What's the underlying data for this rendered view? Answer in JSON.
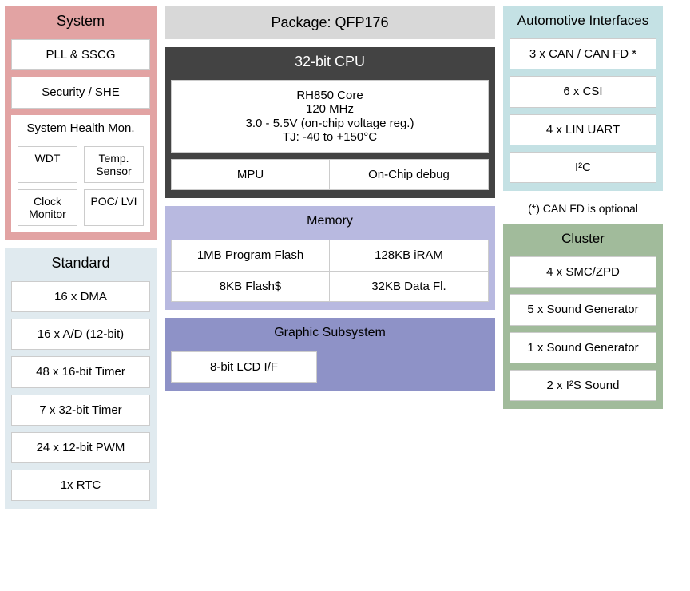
{
  "system": {
    "title": "System",
    "items": [
      "PLL & SSCG",
      "Security / SHE"
    ],
    "health": {
      "title": "System Health Mon.",
      "cells": [
        "WDT",
        "Temp. Sensor",
        "Clock Monitor",
        "POC/ LVI"
      ]
    }
  },
  "standard": {
    "title": "Standard",
    "items": [
      "16 x DMA",
      "16 x A/D (12-bit)",
      "48 x 16-bit Timer",
      "7 x 32-bit Timer",
      "24 x 12-bit PWM",
      "1x RTC"
    ]
  },
  "package_title": "Package:  QFP176",
  "cpu": {
    "title": "32-bit CPU",
    "core_lines": [
      "RH850 Core",
      "120 MHz",
      "3.0 - 5.5V (on-chip voltage reg.)",
      "TJ: -40 to +150°C"
    ],
    "sub": [
      "MPU",
      "On-Chip debug"
    ]
  },
  "memory": {
    "title": "Memory",
    "row1": [
      "1MB Program Flash",
      "128KB iRAM"
    ],
    "row2": [
      "8KB Flash$",
      "32KB Data Fl."
    ]
  },
  "graphic": {
    "title": "Graphic Subsystem",
    "item": "8-bit LCD I/F"
  },
  "auto": {
    "title": "Automotive Interfaces",
    "items": [
      "3 x CAN / CAN FD *",
      "6 x CSI",
      "4 x LIN UART",
      "I²C"
    ]
  },
  "note": "(*) CAN FD is optional",
  "cluster": {
    "title": "Cluster",
    "items": [
      "4 x SMC/ZPD",
      "5 x Sound Generator",
      "1 x Sound Generator",
      "2 x I²S Sound"
    ]
  }
}
